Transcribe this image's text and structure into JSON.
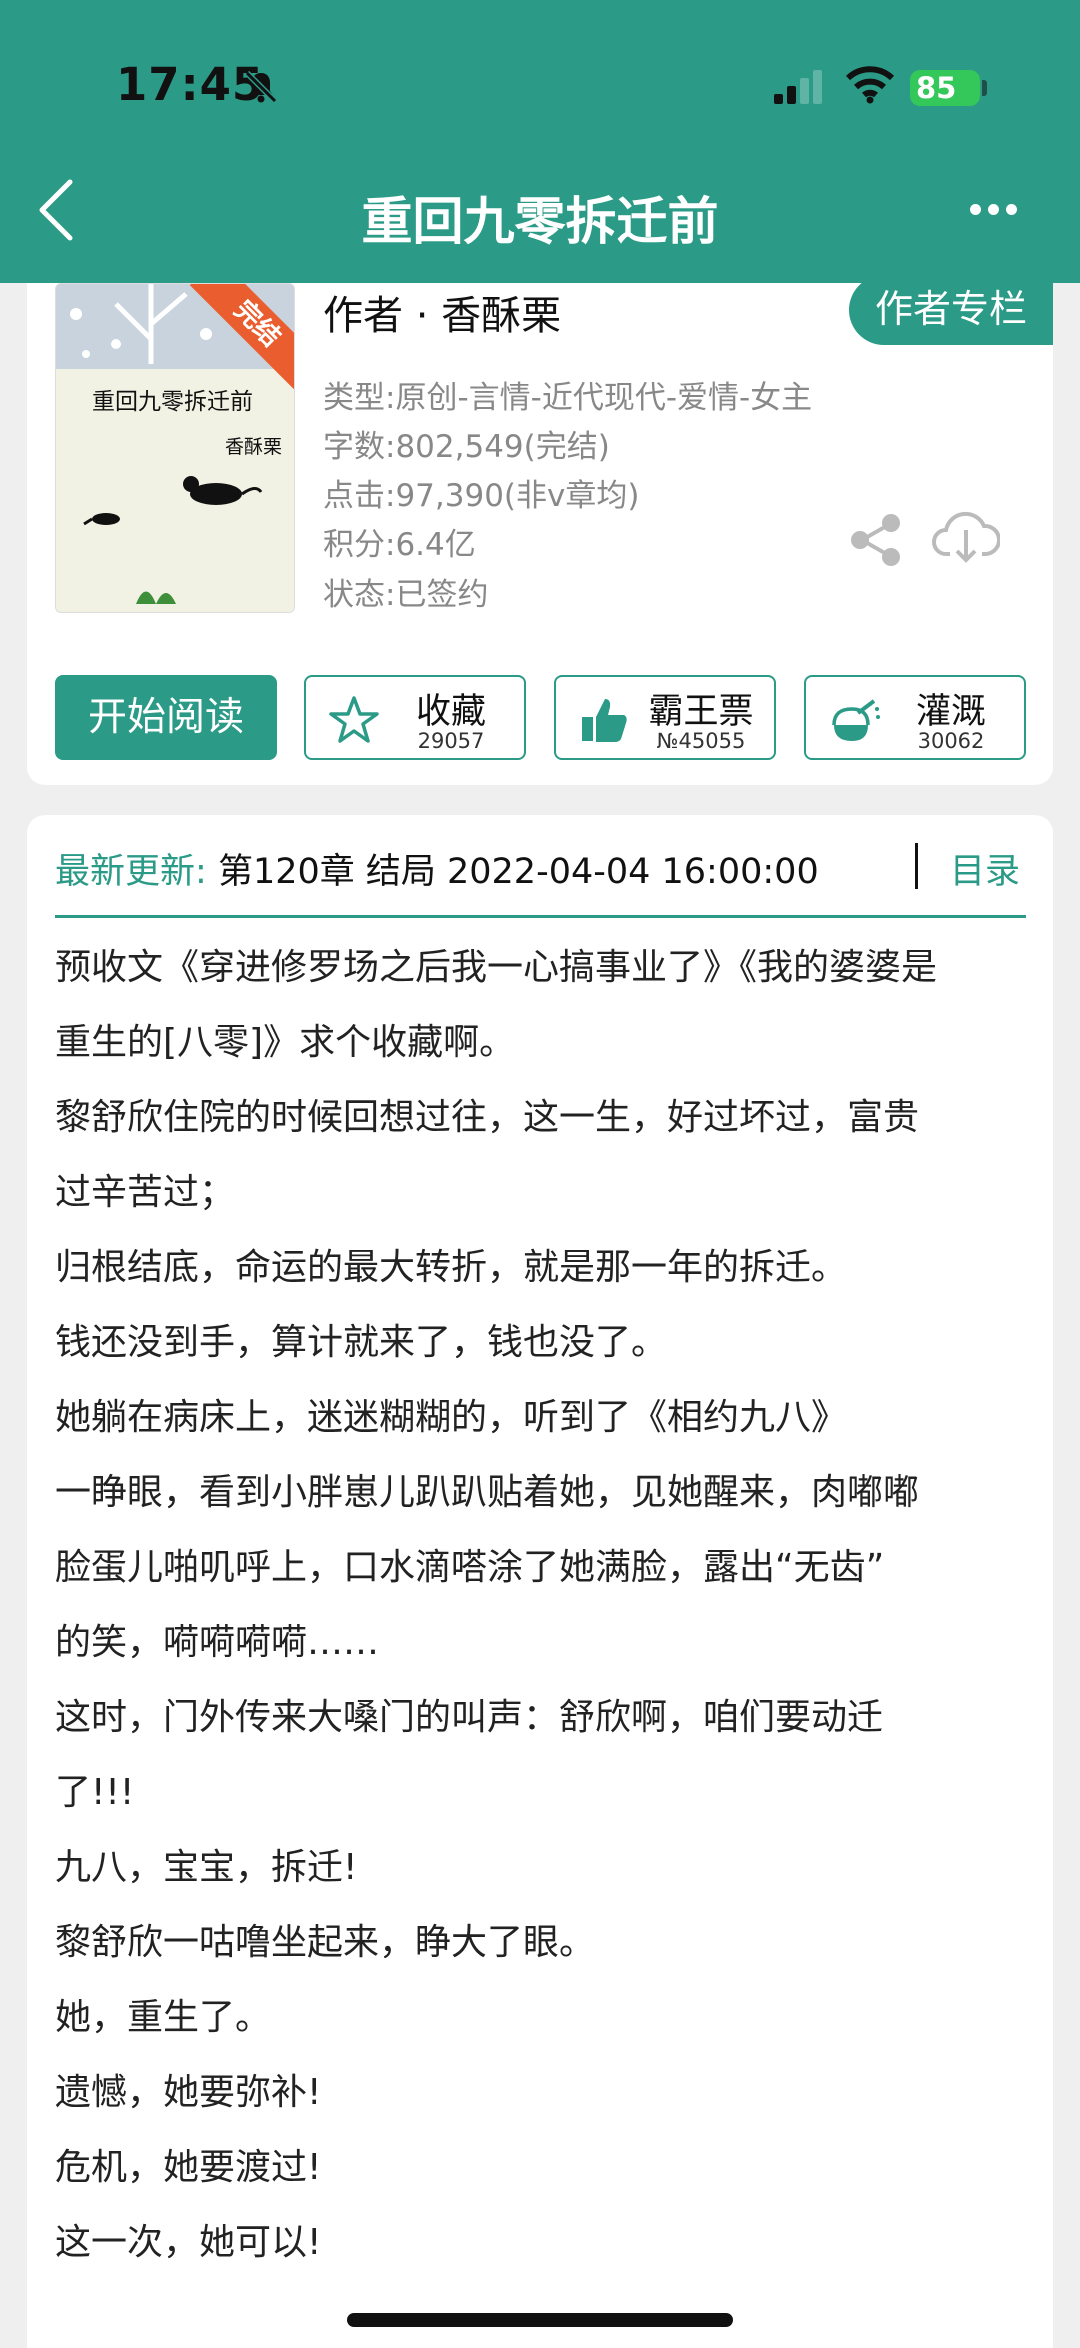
{
  "status_bar": {
    "time": "17:45",
    "battery": "85"
  },
  "header": {
    "title": "重回九零拆迁前"
  },
  "book": {
    "cover_title": "重回九零拆迁前",
    "cover_author": "香酥栗",
    "cover_badge": "完结",
    "author_line": "作者 · 香酥栗",
    "author_column_button": "作者专栏",
    "meta": [
      "类型:原创-言情-近代现代-爱情-女主",
      "字数:802,549(完结)",
      "点击:97,390(非v章均)",
      "积分:6.4亿",
      "状态:已签约"
    ]
  },
  "actions": {
    "start_reading": "开始阅读",
    "collect": {
      "label": "收藏",
      "count": "29057"
    },
    "bawang": {
      "label": "霸王票",
      "count": "№45055"
    },
    "irrigate": {
      "label": "灌溉",
      "count": "30062"
    }
  },
  "update": {
    "label": "最新更新:",
    "text": "第120章 结局 2022-04-04 16:00:00",
    "toc": "目录"
  },
  "synopsis": [
    "预收文《穿进修罗场之后我一心搞事业了》《我的婆婆是",
    "重生的[八零]》求个收藏啊。",
    "黎舒欣住院的时候回想过往，这一生，好过坏过，富贵",
    "过辛苦过；",
    "归根结底，命运的最大转折，就是那一年的拆迁。",
    "钱还没到手，算计就来了，钱也没了。",
    "她躺在病床上，迷迷糊糊的，听到了《相约九八》",
    "一睁眼，看到小胖崽儿趴趴贴着她，见她醒来，肉嘟嘟",
    "脸蛋儿啪叽呼上，口水滴嗒涂了她满脸，露出“无齿”",
    "的笑，嗬嗬嗬嗬……",
    "这时，门外传来大嗓门的叫声：舒欣啊，咱们要动迁",
    "了!!!",
    "九八，宝宝，拆迁!",
    "黎舒欣一咕噜坐起来，睁大了眼。",
    "她，重生了。",
    "遗憾，她要弥补!",
    "危机，她要渡过!",
    "这一次，她可以!"
  ]
}
